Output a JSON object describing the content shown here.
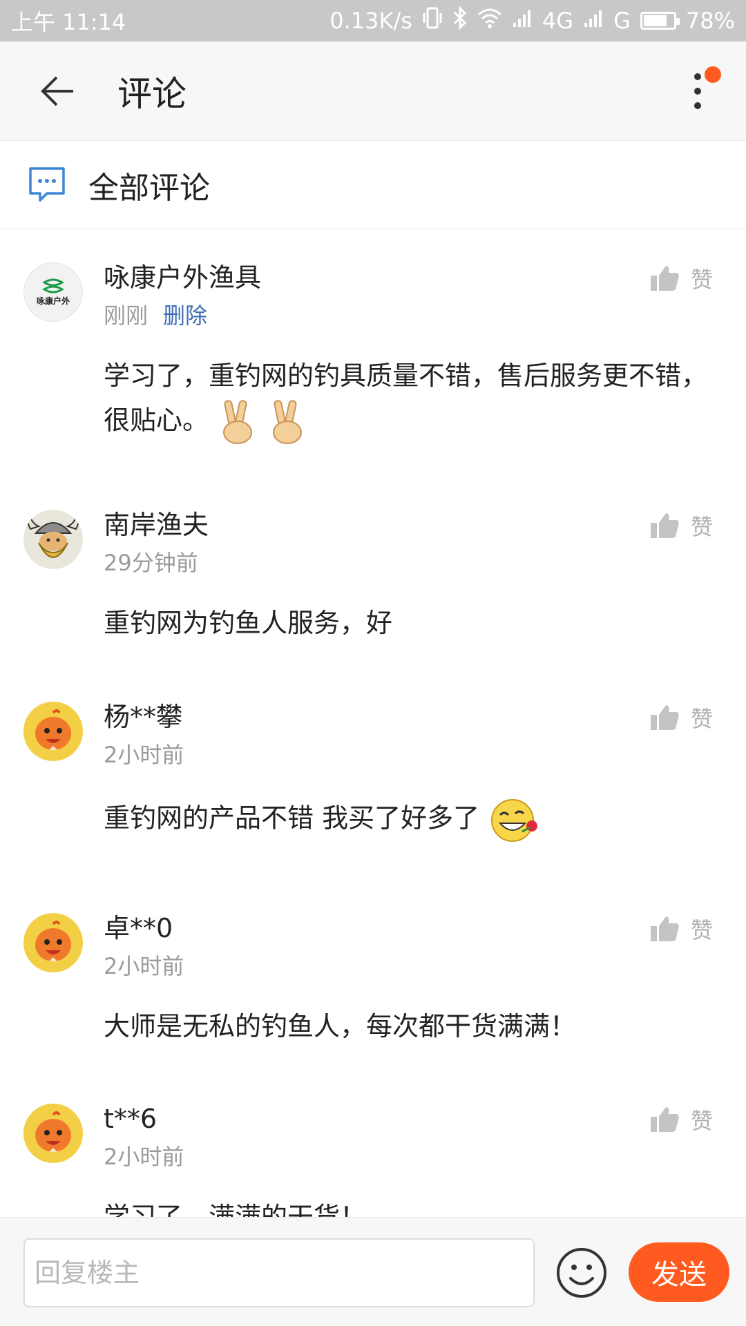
{
  "status_bar": {
    "time": "上午 11:14",
    "net_speed": "0.13K/s",
    "network": "4G",
    "network2": "G",
    "battery_level": 0.78,
    "battery_text": "78%"
  },
  "app_bar": {
    "title": "评论",
    "back_icon": "arrow-left-icon",
    "more_icon": "more-vertical-icon",
    "notification_color": "#ff5a1f"
  },
  "section": {
    "label": "全部评论",
    "icon": "chat-bubble-icon",
    "icon_color": "#3d86d6"
  },
  "comments": [
    {
      "name": "咏康户外渔具",
      "time": "刚刚",
      "delete_label": "删除",
      "content": "学习了，重钓网的钓具质量不错，售后服务更不错，很贴心。",
      "emoji": [
        "victory-hand-icon",
        "victory-hand-icon"
      ],
      "avatar": "brand-logo-avatar",
      "avatar_text": "咏康户外",
      "like_label": "赞"
    },
    {
      "name": "南岸渔夫",
      "time": "29分钟前",
      "content": "重钓网为钓鱼人服务，好",
      "avatar": "viking-avatar",
      "like_label": "赞"
    },
    {
      "name": "杨**攀",
      "time": "2小时前",
      "content": "重钓网的产品不错 我买了好多了",
      "emoji": [
        "grin-with-rose-icon"
      ],
      "avatar": "mascot-avatar",
      "like_label": "赞"
    },
    {
      "name": "卓**0",
      "time": "2小时前",
      "content": "大师是无私的钓鱼人，每次都干货满满！",
      "avatar": "mascot-avatar",
      "like_label": "赞"
    },
    {
      "name": "t**6",
      "time": "2小时前",
      "content": "学习了，满满的干货！",
      "avatar": "mascot-avatar",
      "like_label": "赞"
    }
  ],
  "bottom_bar": {
    "reply_placeholder": "回复楼主",
    "smile_icon": "smiley-face-icon",
    "send_label": "发送",
    "send_color": "#ff5a1f"
  }
}
